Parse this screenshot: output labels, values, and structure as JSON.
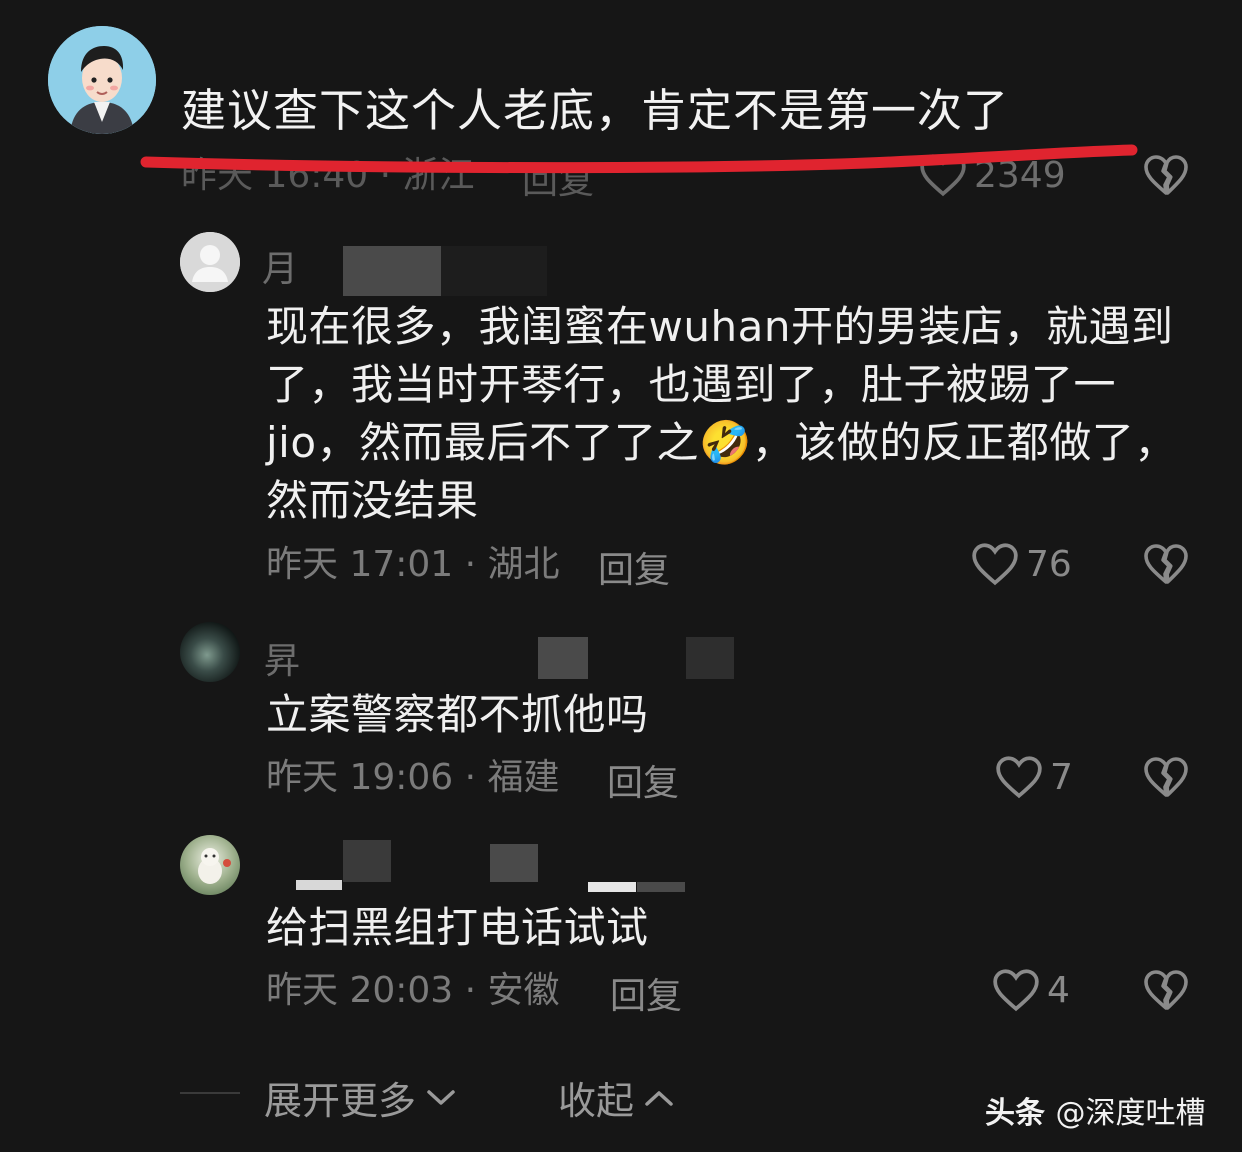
{
  "main_comment": {
    "text": "建议查下这个人老底，肯定不是第一次了",
    "meta": "昨天 16:40 · 浙江",
    "reply_label": "回复",
    "likes": "2349",
    "highlight_color": "#e0242f"
  },
  "replies": [
    {
      "text": "现在很多，我闺蜜在wuhan开的男装店，就遇到了，我当时开琴行，也遇到了，肚子被踢了一jio，然而最后不了了之🤣，该做的反正都做了，然而没结果",
      "meta": "昨天 17:01 · 湖北",
      "reply_label": "回复",
      "likes": "76",
      "avatar": "default-avatar-icon"
    },
    {
      "text": "立案警察都不抓他吗",
      "meta": "昨天 19:06 · 福建",
      "reply_label": "回复",
      "likes": "7",
      "avatar": "moon-avatar"
    },
    {
      "text": "给扫黑组打电话试试",
      "meta": "昨天 20:03 · 安徽",
      "reply_label": "回复",
      "likes": "4",
      "avatar": "animal-avatar"
    }
  ],
  "footer": {
    "expand_more": "展开更多",
    "collapse": "收起"
  },
  "watermark": {
    "brand": "头条",
    "handle": "@深度吐槽"
  }
}
